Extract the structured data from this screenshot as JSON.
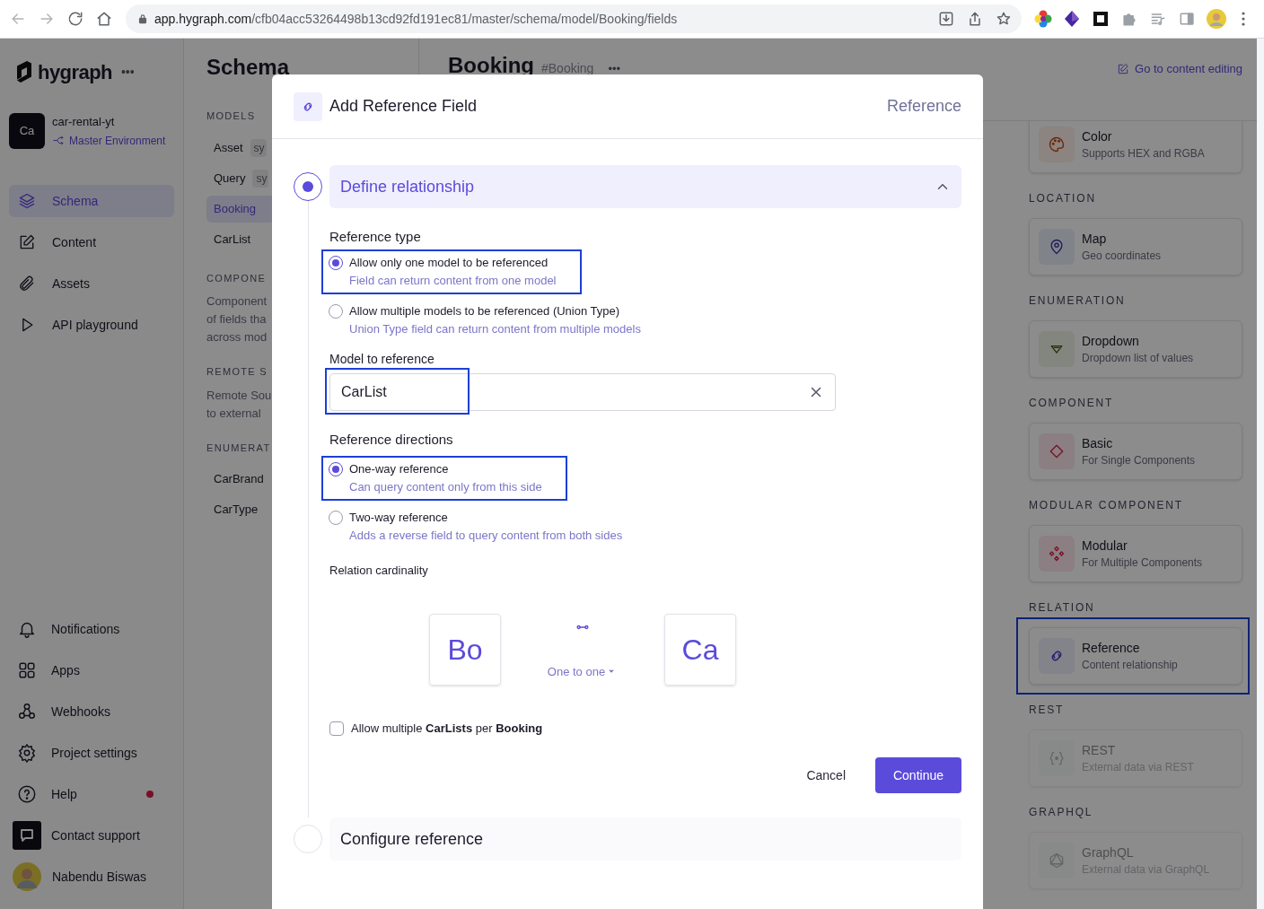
{
  "browser": {
    "url_host": "app.hygraph.com",
    "url_path": "/cfb04acc53264498b13cd92fd191ec81/master/schema/model/Booking/fields"
  },
  "sidebar": {
    "brand": "hygraph",
    "brand_menu": "•••",
    "project": {
      "avatar": "Ca",
      "name": "car-rental-yt",
      "environment": "Master Environment"
    },
    "nav": [
      {
        "label": "Schema",
        "selected": true
      },
      {
        "label": "Content",
        "selected": false
      },
      {
        "label": "Assets",
        "selected": false
      },
      {
        "label": "API playground",
        "selected": false
      }
    ],
    "bottom_nav": [
      {
        "label": "Notifications",
        "dot": false
      },
      {
        "label": "Apps",
        "dot": false
      },
      {
        "label": "Webhooks",
        "dot": false
      },
      {
        "label": "Project settings",
        "dot": false
      },
      {
        "label": "Help",
        "dot": true
      },
      {
        "label": "Contact support",
        "dot": false
      }
    ],
    "user": {
      "name": "Nabendu Biswas"
    }
  },
  "schema_panel": {
    "title": "Schema",
    "sections": [
      {
        "heading": "MODELS",
        "items": [
          {
            "label": "Asset",
            "tag": "sy",
            "selected": false
          },
          {
            "label": "Query",
            "tag": "sy",
            "selected": false
          },
          {
            "label": "Booking",
            "selected": true
          },
          {
            "label": "CarList",
            "selected": false
          }
        ]
      },
      {
        "heading": "COMPONE",
        "lines": [
          "Component",
          "of fields tha",
          "across mod"
        ]
      },
      {
        "heading": "REMOTE S",
        "lines": [
          "Remote Sou",
          "to external"
        ]
      },
      {
        "heading": "ENUMERAT",
        "items": [
          {
            "label": "CarBrand",
            "selected": false
          },
          {
            "label": "CarType",
            "selected": false
          }
        ]
      }
    ]
  },
  "main": {
    "title": "Booking",
    "api_id": "#Booking",
    "menu": "•••",
    "content_link": "Go to content editing",
    "field_groups": [
      {
        "cards": [
          {
            "title": "Color",
            "description": "Supports HEX and RGBA",
            "highlighted": false,
            "disabled": false
          }
        ]
      },
      {
        "heading": "LOCATION",
        "cards": [
          {
            "title": "Map",
            "description": "Geo coordinates",
            "highlighted": false,
            "disabled": false
          }
        ]
      },
      {
        "heading": "ENUMERATION",
        "cards": [
          {
            "title": "Dropdown",
            "description": "Dropdown list of values",
            "highlighted": false,
            "disabled": false
          }
        ]
      },
      {
        "heading": "COMPONENT",
        "cards": [
          {
            "title": "Basic",
            "description": "For Single Components",
            "highlighted": false,
            "disabled": false
          }
        ]
      },
      {
        "heading": "MODULAR COMPONENT",
        "cards": [
          {
            "title": "Modular",
            "description": "For Multiple Components",
            "highlighted": false,
            "disabled": false
          }
        ]
      },
      {
        "heading": "RELATION",
        "cards": [
          {
            "title": "Reference",
            "description": "Content relationship",
            "highlighted": true,
            "disabled": false
          }
        ]
      },
      {
        "heading": "REST",
        "cards": [
          {
            "title": "REST",
            "description": "External data via REST",
            "highlighted": false,
            "disabled": true
          }
        ]
      },
      {
        "heading": "GRAPHQL",
        "cards": [
          {
            "title": "GraphQL",
            "description": "External data via GraphQL",
            "highlighted": false,
            "disabled": true
          }
        ]
      }
    ]
  },
  "modal": {
    "title": "Add Reference Field",
    "type_label": "Reference",
    "steps": [
      {
        "title": "Define relationship",
        "active": true,
        "expanded": true
      },
      {
        "title": "Configure reference",
        "active": false,
        "expanded": false
      }
    ],
    "reference_type": {
      "label": "Reference type",
      "options": [
        {
          "label": "Allow only one model to be referenced",
          "description": "Field can return content from one model",
          "selected": true,
          "highlighted": true
        },
        {
          "label": "Allow multiple models to be referenced (Union Type)",
          "description": "Union Type field can return content from multiple models",
          "selected": false,
          "highlighted": false
        }
      ]
    },
    "model_field": {
      "label": "Model to reference",
      "value": "CarList",
      "highlighted": true
    },
    "directions": {
      "label": "Reference directions",
      "options": [
        {
          "label": "One-way reference",
          "description": "Can query content only from this side",
          "selected": true,
          "highlighted": true
        },
        {
          "label": "Two-way reference",
          "description": "Adds a reverse field to query content from both sides",
          "selected": false,
          "highlighted": false
        }
      ]
    },
    "cardinality": {
      "label": "Relation cardinality",
      "source": "Bo",
      "relation": "One to one",
      "target": "Ca"
    },
    "multiple": {
      "label": "Allow multiple **CarLists** per **Booking**",
      "checked": false
    },
    "buttons": {
      "cancel": "Cancel",
      "continue": "Continue"
    }
  }
}
